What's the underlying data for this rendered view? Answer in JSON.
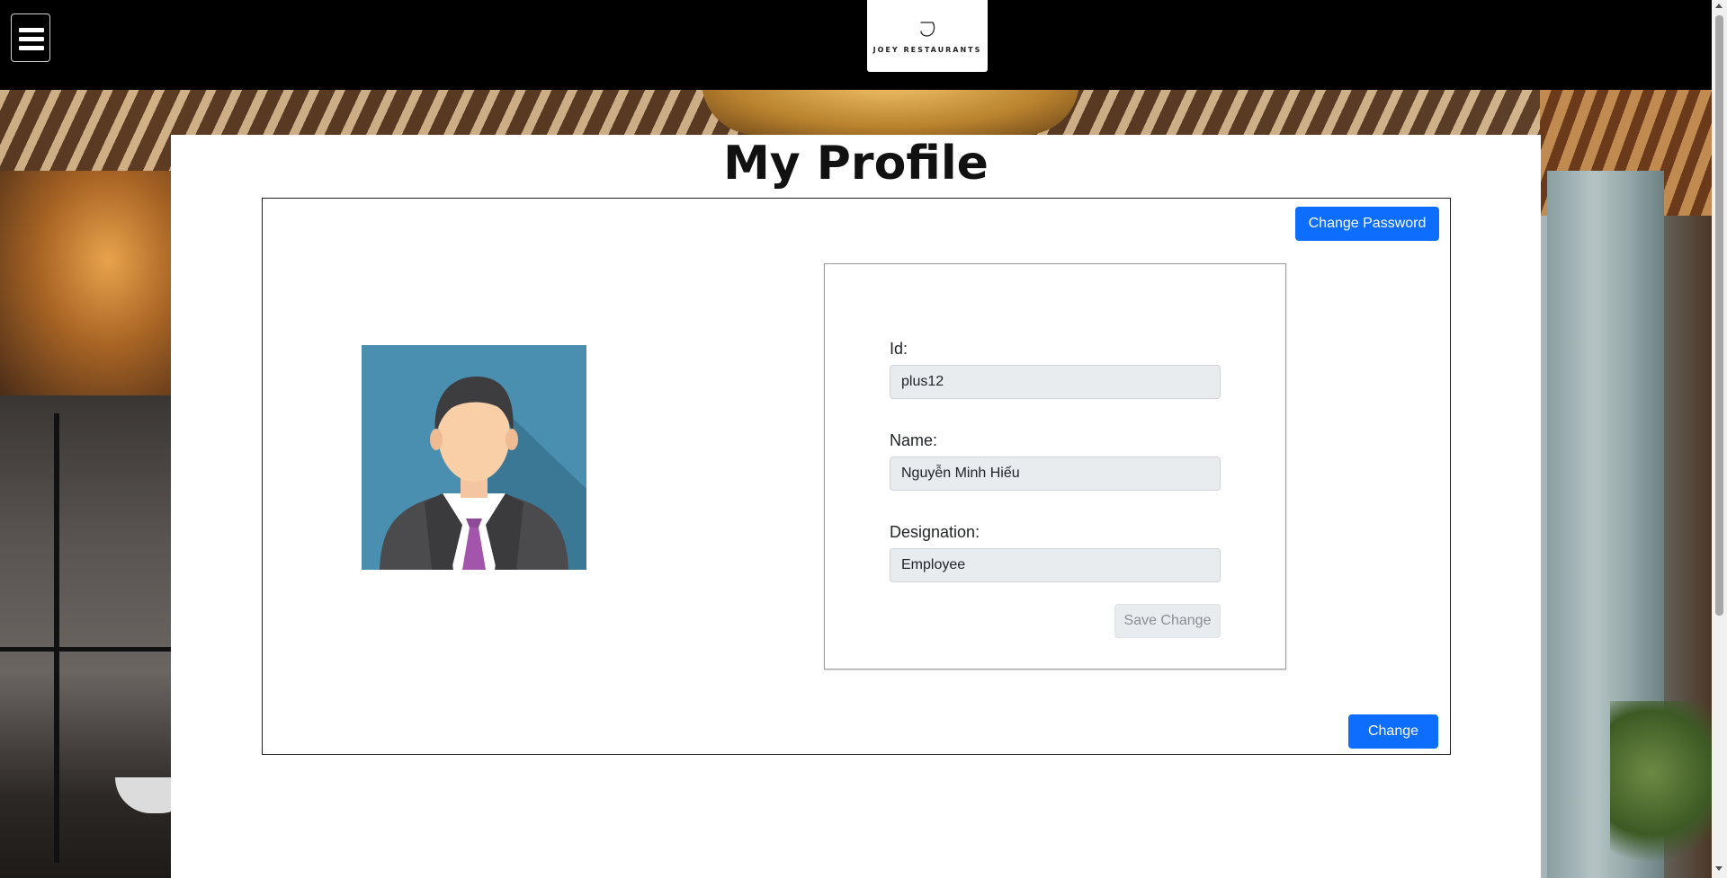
{
  "header": {
    "menu_icon": "hamburger-menu-icon",
    "logo_text": "JOEY RESTAURANTS"
  },
  "page": {
    "title": "My Profile"
  },
  "profile": {
    "avatar_icon": "businessman-avatar-icon",
    "change_password_label": "Change Password",
    "change_label": "Change",
    "fields": {
      "id_label": "Id:",
      "id_value": "plus12",
      "name_label": "Name:",
      "name_value": "Nguyễn Minh Hiếu",
      "designation_label": "Designation:",
      "designation_value": "Employee"
    },
    "save_label": "Save Change"
  },
  "colors": {
    "primary_button": "#0d6efd",
    "readonly_input_bg": "#e9ecef",
    "topbar_bg": "#000000"
  }
}
